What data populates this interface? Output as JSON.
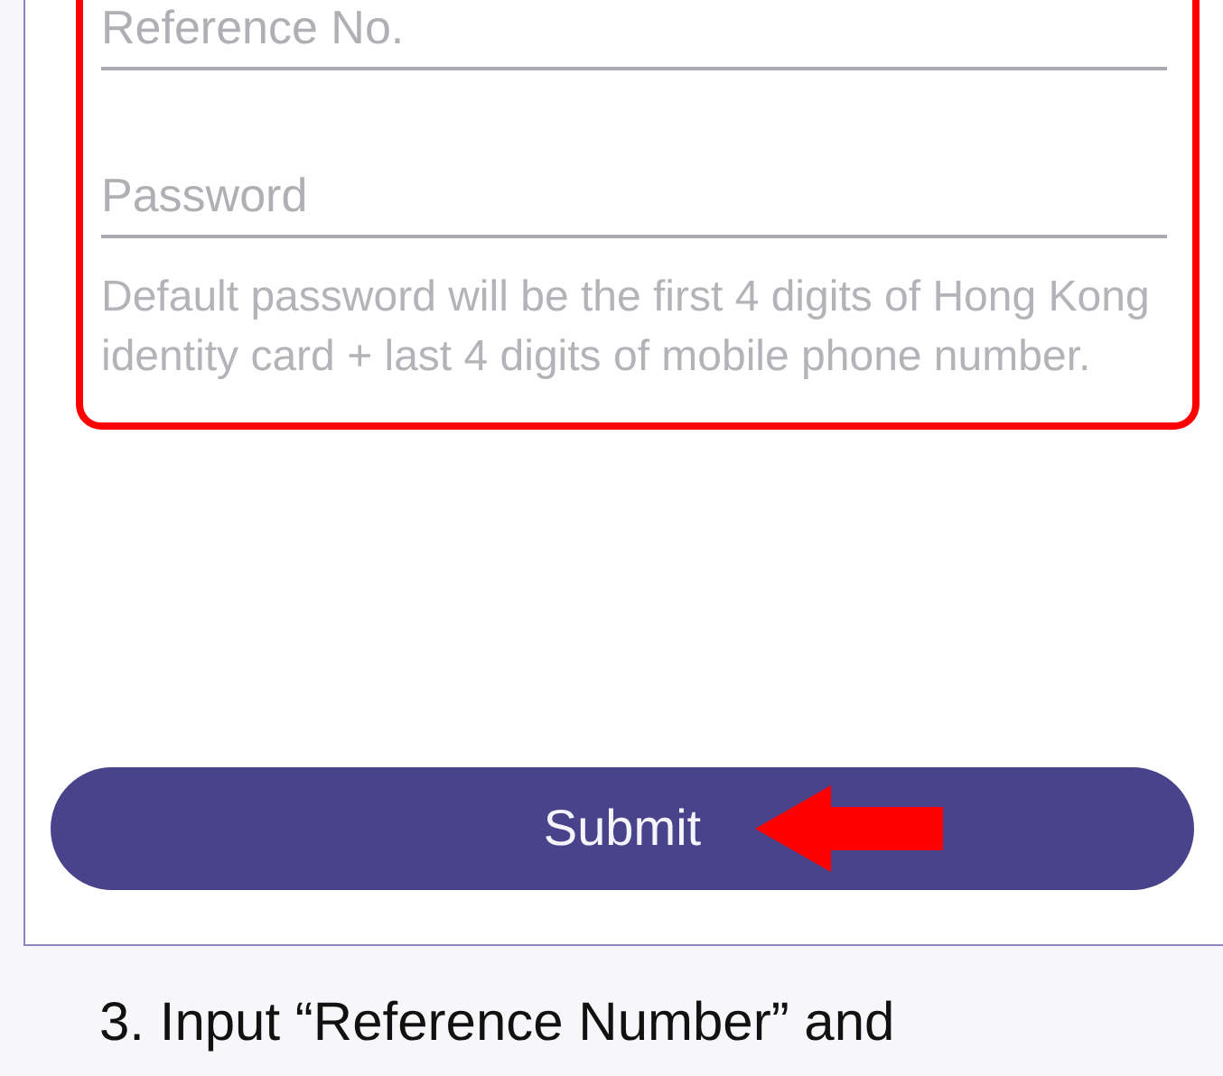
{
  "form": {
    "fields": [
      {
        "placeholder": "Reference No."
      },
      {
        "placeholder": "Password"
      }
    ],
    "hint": "Default password will be the first 4 digits of Hong Kong identity card + last 4 digits of mobile phone number.",
    "submit_button": {
      "label": "Submit"
    }
  },
  "caption": "3. Input “Reference Number” and"
}
